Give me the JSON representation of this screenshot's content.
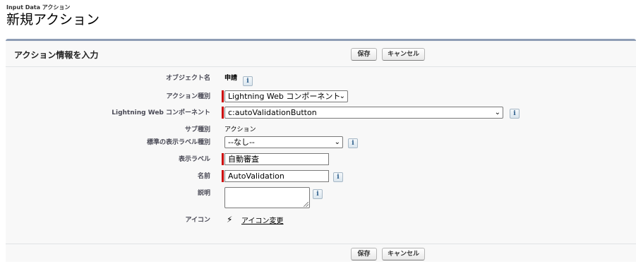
{
  "page": {
    "subtitle": "Input Data アクション",
    "title": "新規アクション"
  },
  "section": {
    "title": "アクション情報を入力",
    "save_label": "保存",
    "cancel_label": "キャンセル"
  },
  "form": {
    "object_name": {
      "label": "オブジェクト名",
      "value": "申請"
    },
    "action_type": {
      "label": "アクション種別",
      "selected": "Lightning Web コンポーネント"
    },
    "lwc": {
      "label": "Lightning Web コンポーネント",
      "selected": "c:autoValidationButton"
    },
    "subtype": {
      "label": "サブ種別",
      "value": "アクション"
    },
    "standard_label_type": {
      "label": "標準の表示ラベル種別",
      "selected": "--なし--"
    },
    "display_label": {
      "label": "表示ラベル",
      "value": "自動審査"
    },
    "name": {
      "label": "名前",
      "value": "AutoValidation"
    },
    "description": {
      "label": "説明",
      "value": ""
    },
    "icon": {
      "label": "アイコン",
      "icon_name": "lightning-bolt-icon",
      "link": "アイコン変更"
    }
  },
  "info_icon_glyph": "i",
  "colors": {
    "panel_border": "#8e9db5",
    "required_bar": "#cc0000",
    "panel_bg": "#f8f8f8"
  }
}
